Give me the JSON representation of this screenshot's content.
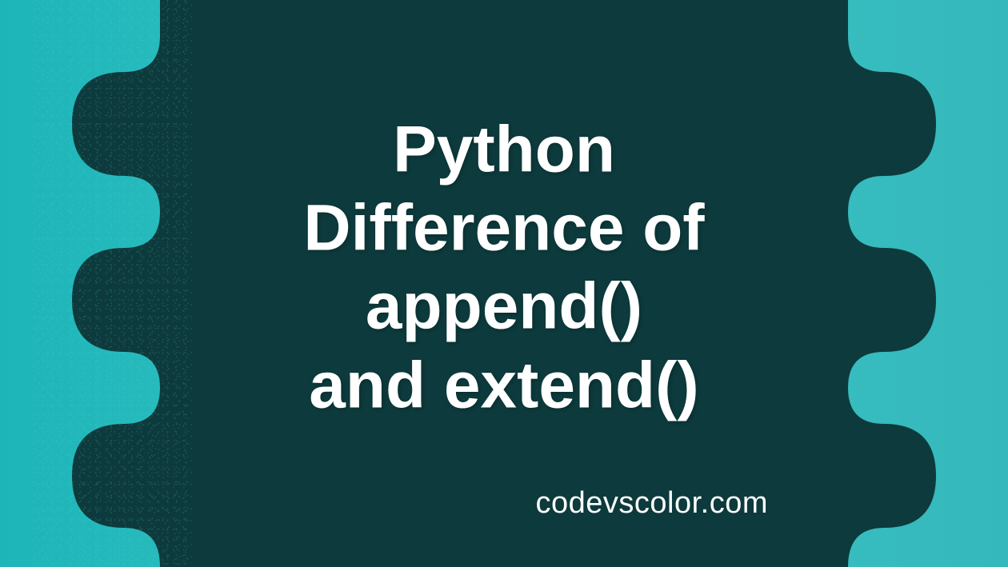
{
  "title": {
    "line1": "Python",
    "line2": "Difference of",
    "line3": "append()",
    "line4": "and extend()"
  },
  "footer": "codevscolor.com",
  "colors": {
    "blob": "#0d3a3c",
    "background_start": "#1db5b8",
    "background_end": "#35b8bb",
    "text": "#ffffff"
  }
}
